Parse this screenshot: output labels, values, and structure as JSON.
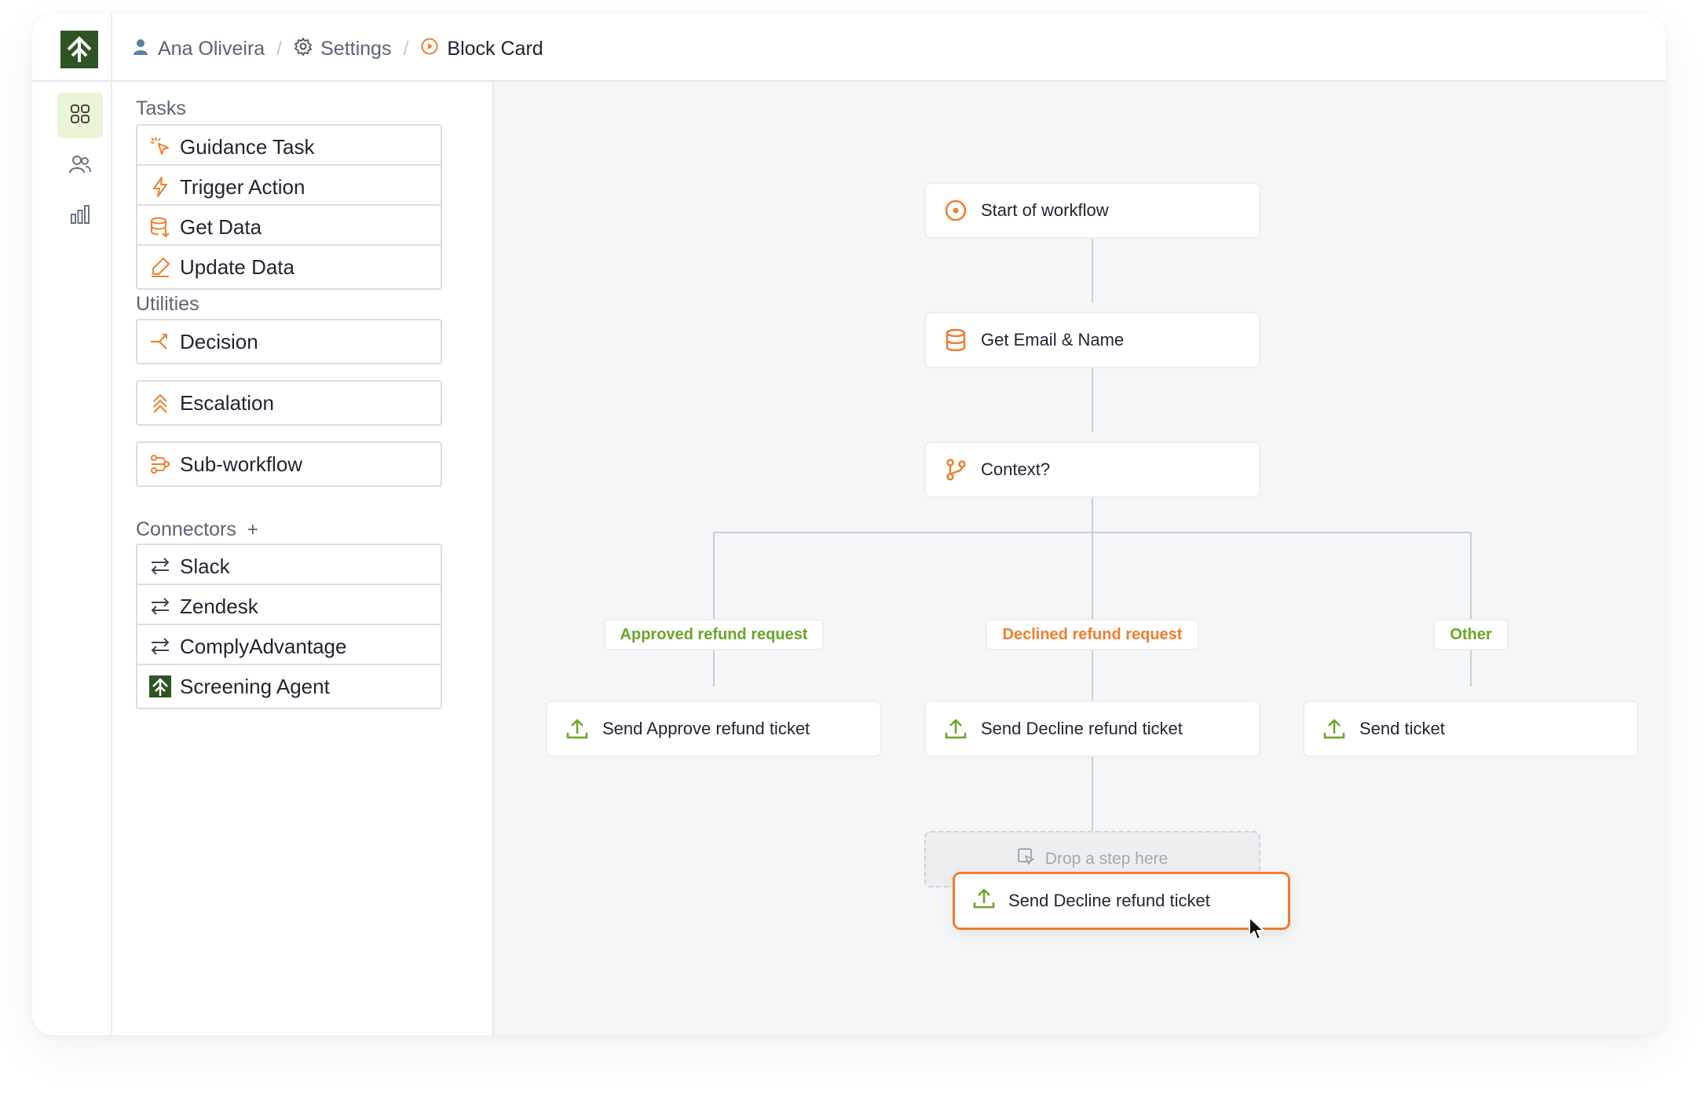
{
  "breadcrumb": {
    "user": "Ana Oliveira",
    "settings": "Settings",
    "current": "Block Card",
    "separator": "/"
  },
  "colors": {
    "accent": "#ef7d2d",
    "brand": "#2f5424",
    "approved": "#6aa526",
    "declined": "#ef7d2d",
    "other": "#6aa526"
  },
  "sidebar": {
    "tasks_title": "Tasks",
    "tasks": [
      {
        "label": "Guidance Task",
        "icon": "cursor-click-icon"
      },
      {
        "label": "Trigger Action",
        "icon": "bolt-icon"
      },
      {
        "label": "Get Data",
        "icon": "database-download-icon"
      },
      {
        "label": "Update Data",
        "icon": "pen-icon"
      }
    ],
    "utilities_title": "Utilities",
    "utilities": [
      {
        "label": "Decision",
        "icon": "split-icon"
      },
      {
        "label": "Escalation",
        "icon": "chevrons-up-icon"
      },
      {
        "label": "Sub-workflow",
        "icon": "route-icon"
      }
    ],
    "connectors_title": "Connectors",
    "connectors_add": "+",
    "connectors": [
      {
        "label": "Slack",
        "icon": "arrows-exchange-icon"
      },
      {
        "label": "Zendesk",
        "icon": "arrows-exchange-icon"
      },
      {
        "label": "ComplyAdvantage",
        "icon": "arrows-exchange-icon"
      },
      {
        "label": "Screening Agent",
        "icon": "brand-logo-icon"
      }
    ]
  },
  "workflow": {
    "start": "Start of workflow",
    "get_data": "Get Email & Name",
    "decision": "Context?",
    "branches": [
      {
        "label": "Approved refund request",
        "action": "Send Approve refund ticket"
      },
      {
        "label": "Declined refund request",
        "action": "Send Decline refund ticket"
      },
      {
        "label": "Other",
        "action": "Send ticket"
      }
    ],
    "dropzone": "Drop a step here",
    "dragging": "Send Decline refund ticket"
  }
}
